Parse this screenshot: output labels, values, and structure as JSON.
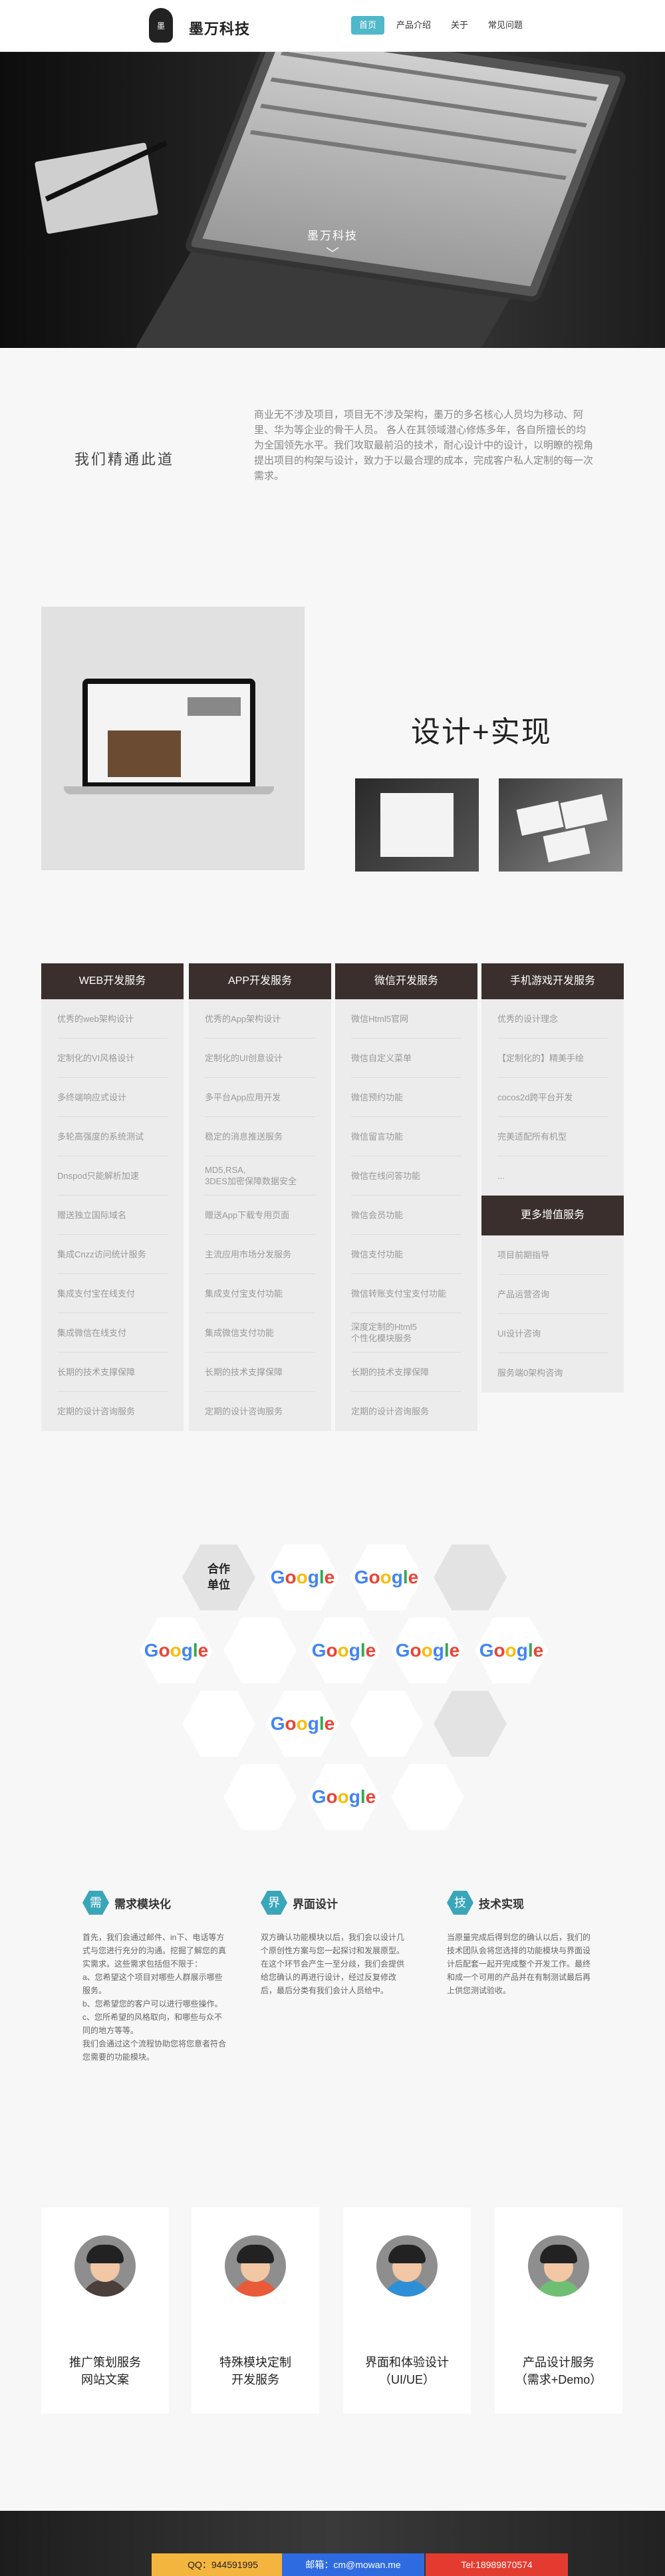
{
  "header": {
    "brand": "墨万科技",
    "logo_glyph": "墨",
    "nav": [
      {
        "label": "首页",
        "active": true
      },
      {
        "label": "产品介绍",
        "active": false
      },
      {
        "label": "关于",
        "active": false
      },
      {
        "label": "常见问题",
        "active": false
      }
    ]
  },
  "hero": {
    "title": "墨万科技",
    "chevron": "﹀"
  },
  "intro": {
    "title": "我们精通此道",
    "text": "商业无不涉及项目，项目无不涉及架构，墨万的多名核心人员均为移动、阿里、华为等企业的骨干人员。 各人在其领域潜心修炼多年，各自所擅长的均为全国领先水平。我们攻取最前沿的技术，耐心设计中的设计，以明瞭的视角提出项目的构架与设计，致力于以最合理的成本，完成客户私人定制的每一次需求。"
  },
  "design": {
    "title": "设计+实现"
  },
  "services": {
    "cols": [
      {
        "title": "WEB开发服务",
        "items": [
          "优秀的web架构设计",
          "定制化的VI风格设计",
          "多终端响应式设计",
          "多轮高强度的系统测试",
          "Dnspod只能解析加速",
          "赠送独立国际域名",
          "集成Cnzz访问统计服务",
          "集成支付宝在线支付",
          "集成微信在线支付",
          "长期的技术支撑保障",
          "定期的设计咨询服务"
        ]
      },
      {
        "title": "APP开发服务",
        "items": [
          "优秀的App架构设计",
          "定制化的UI创意设计",
          "多平台App应用开发",
          "稳定的消息推送服务",
          "MD5,RSA,\n3DES加密保障数据安全",
          "赠送App下载专用页面",
          "主流应用市场分发服务",
          "集成支付宝支付功能",
          "集成微信支付功能",
          "长期的技术支撑保障",
          "定期的设计咨询服务"
        ]
      },
      {
        "title": "微信开发服务",
        "items": [
          "微信Html5官网",
          "微信自定义菜单",
          "微信预约功能",
          "微信留言功能",
          "微信在线问答功能",
          "微信会员功能",
          "微信支付功能",
          "微信转账支付宝支付功能",
          "深度定制的Html5\n个性化模块服务",
          "长期的技术支撑保障",
          "定期的设计咨询服务"
        ]
      },
      {
        "title": "手机游戏开发服务",
        "items": [
          "优秀的设计理念",
          "【定制化的】精美手绘",
          "cocos2d跨平台开发",
          "完美适配所有机型",
          "..."
        ]
      }
    ],
    "extra": {
      "title": "更多增值服务",
      "items": [
        "项目前期指导",
        "产品运营咨询",
        "UI设计咨询",
        "服务端0架构咨询"
      ]
    }
  },
  "partners": {
    "label_line1": "合作",
    "label_line2": "单位",
    "google": [
      "G",
      "o",
      "o",
      "g",
      "l",
      "e"
    ]
  },
  "features": [
    {
      "icon": "需",
      "title": "需求模块化",
      "text": "首先，我们会通过邮件、in下、电话等方式与您进行充分的沟通。挖掘了解您的真实需求。这些需求包括但不限于：\na、您希望这个项目对哪些人群展示哪些服务。\nb、您希望您的客户可以进行哪些操作。\nc、您所希望的风格取向，和哪些与众不同的地方等等。\n    我们会通过这个流程协助您将您意者符合您需要的功能模块。"
    },
    {
      "icon": "界",
      "title": "界面设计",
      "text": "双方确认功能模块以后，我们会以设计几个原创性方案与您一起探讨和发展原型。在这个环节会产生一至分歧，我们会提供给您确认的再进行设计，经过反复修改后，最后分类有我们会计人员给中。"
    },
    {
      "icon": "技",
      "title": "技术实现",
      "text": "当原量完成后得到您的确认以后，我们的技术团队会将您选择的功能模块与界面设计后配套一起开完成整个开发工作。最终和成一个可用的产品并在有制测试最后再上供您测试验收。"
    }
  ],
  "team": [
    {
      "line1": "推广策划服务",
      "line2": "网站文案",
      "shirt": "#4a3f3a",
      "bg": "#8e8e8e"
    },
    {
      "line1": "特殊模块定制",
      "line2": "开发服务",
      "shirt": "#e85a3a",
      "bg": "#8e8e8e"
    },
    {
      "line1": "界面和体验设计",
      "line2": "（UI/UE）",
      "shirt": "#2f8fd6",
      "bg": "#8e8e8e"
    },
    {
      "line1": "产品设计服务",
      "line2": "（需求+Demo）",
      "shirt": "#6fbf73",
      "bg": "#8e8e8e"
    }
  ],
  "footer": {
    "qq": "QQ：944591995",
    "mail": "邮箱：cm@mowan.me",
    "tel": "Tel:18989870574"
  },
  "colors": {
    "accent": "#4fb8c9",
    "service_head": "#3a2f2c",
    "qq_button": "#f4b53f",
    "mail_button": "#2f6be0",
    "tel_button": "#e33b2f"
  }
}
